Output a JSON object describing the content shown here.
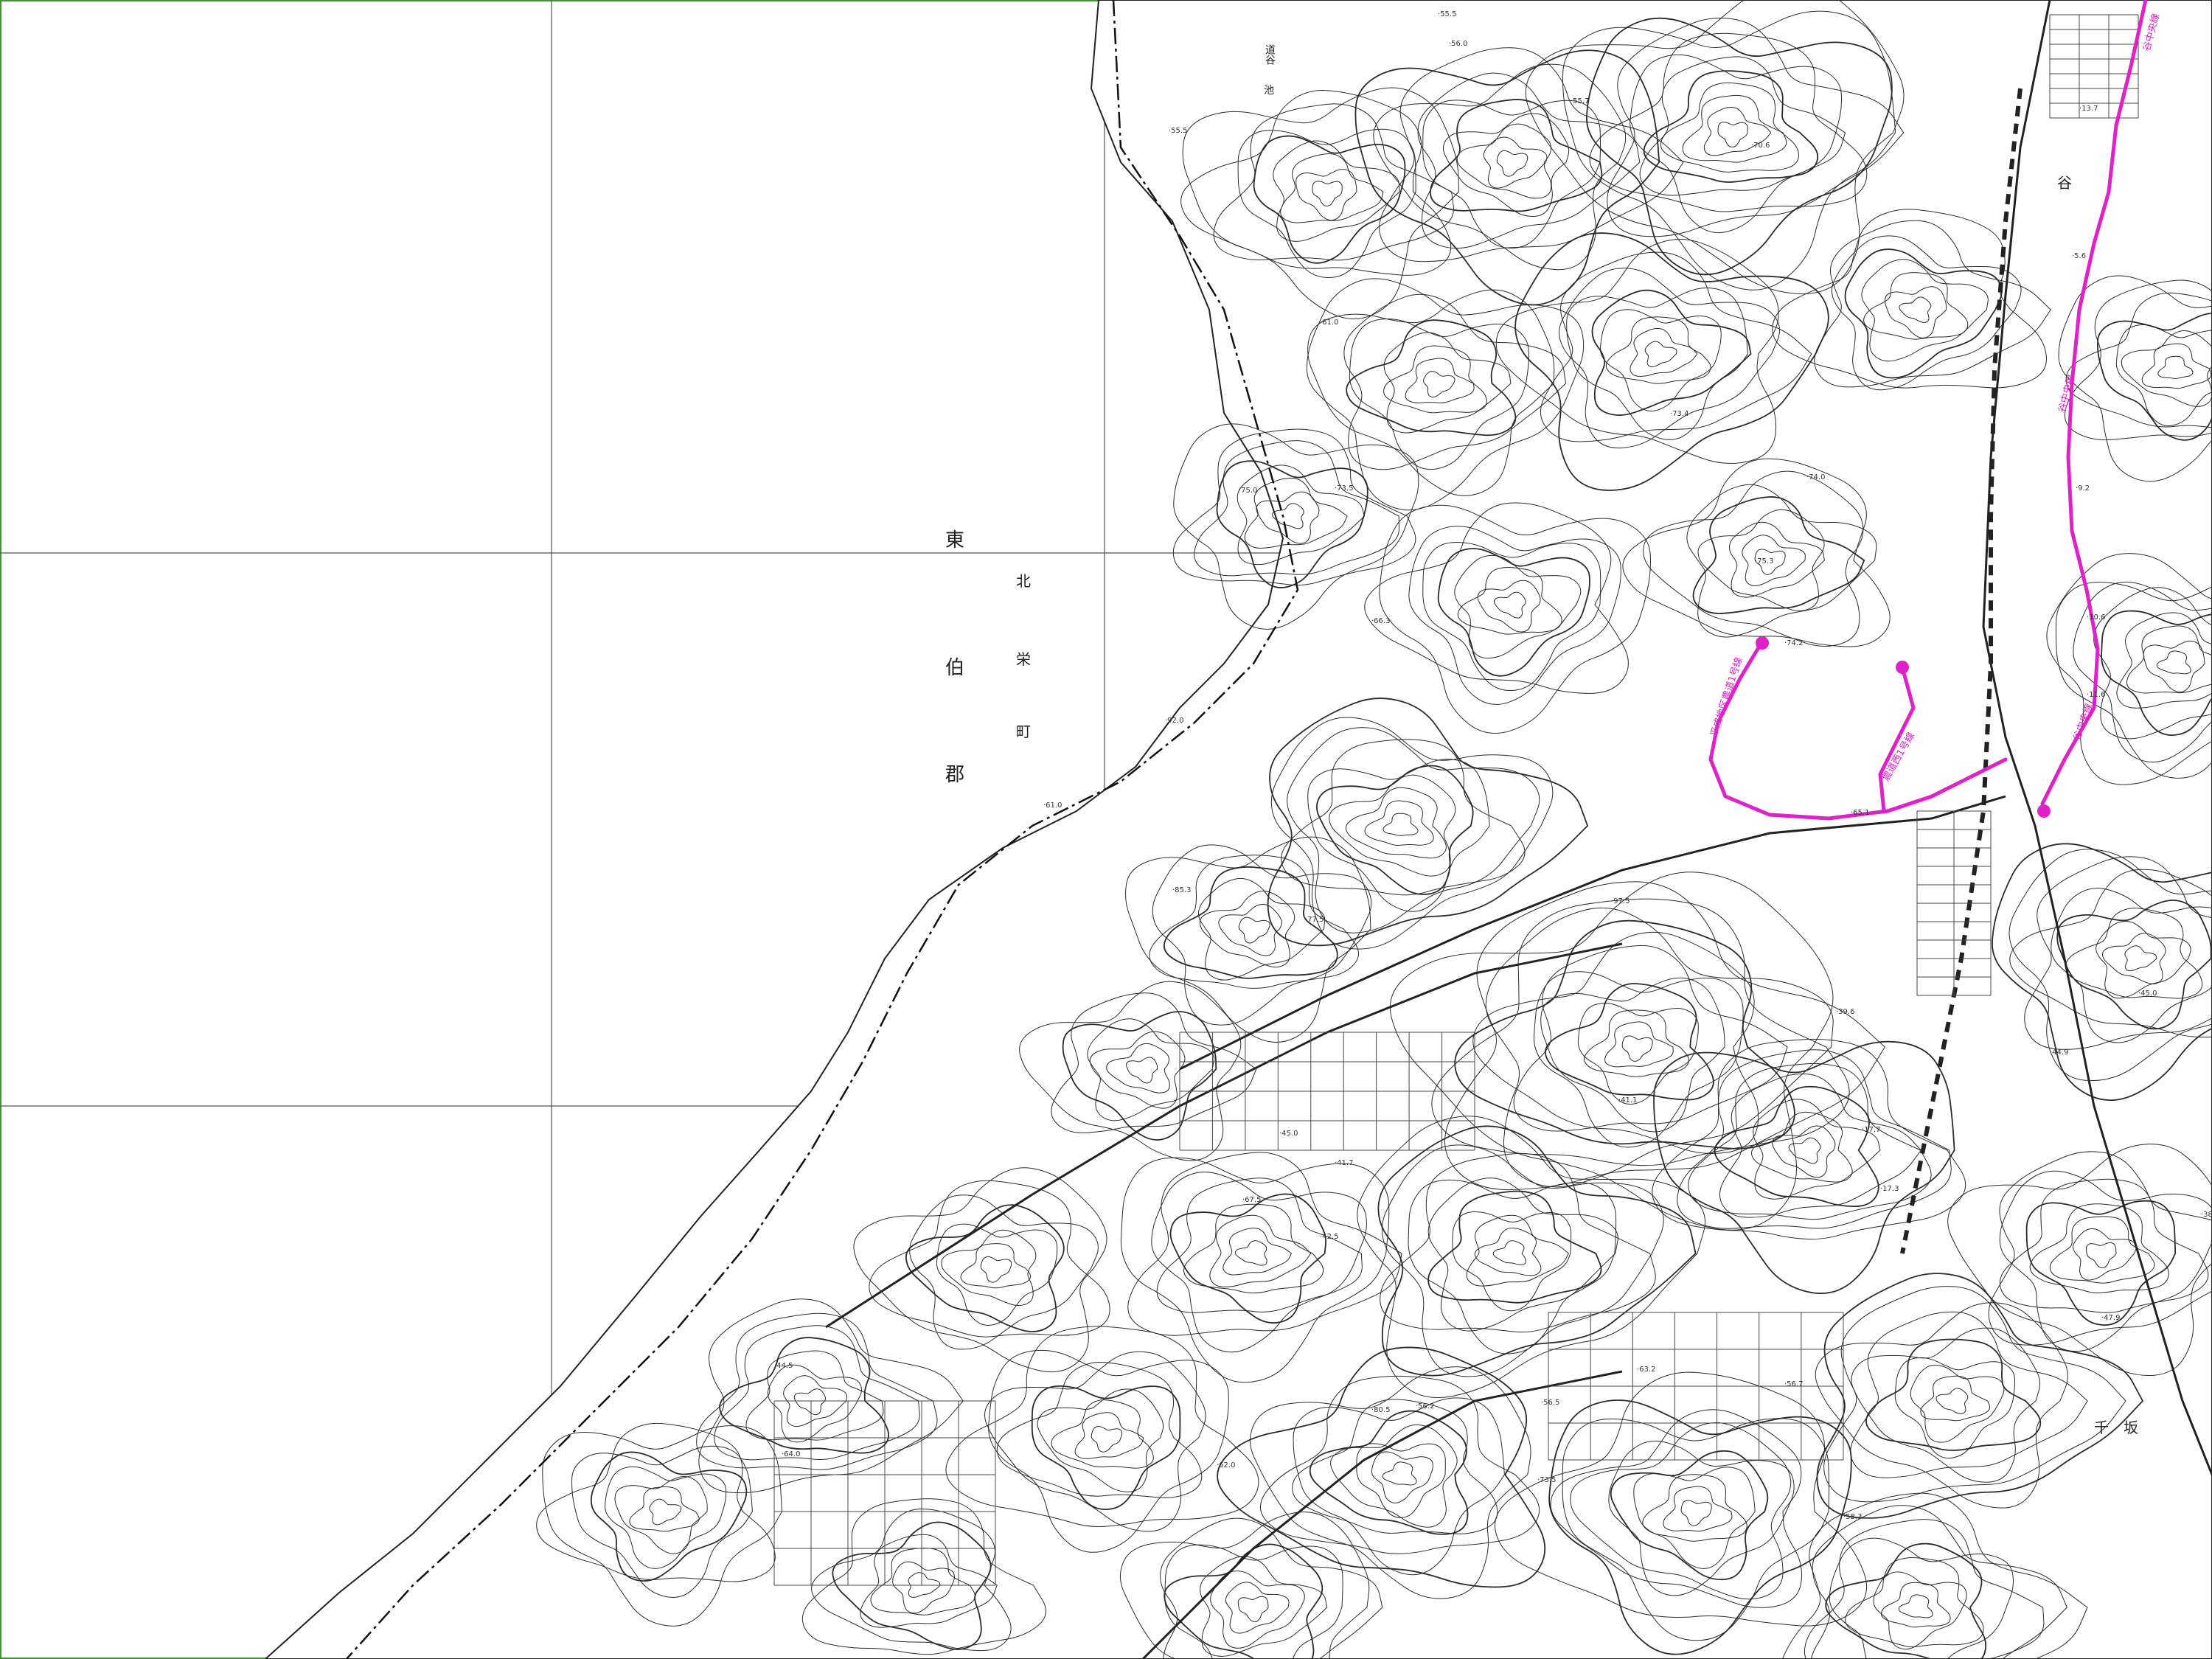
{
  "map": {
    "frame_color": "#3a9a2a",
    "grid_color": "#555555",
    "route_color": "#e020c8",
    "contour_color": "#2b2b2b"
  },
  "labels": {
    "east_label_higashi": "東",
    "east_label_haku": "伯",
    "east_label_gun": "郡",
    "north_label_kita": "北",
    "north_label_ei": "栄",
    "north_label_cho": "町",
    "pond": "池",
    "pond_prefix": "道谷",
    "tani": "谷",
    "senzaka_1": "千",
    "senzaka_2": "坂"
  },
  "routes": [
    {
      "name": "谷中央線"
    },
    {
      "name": "谷中央線"
    },
    {
      "name": "谷中央線"
    },
    {
      "name": "平成地区農道1号線"
    },
    {
      "name": "農道西1号線"
    }
  ],
  "elevations": [
    "55.5",
    "56.0",
    "55.7",
    "55.5",
    "70.6",
    "61.0",
    "75.0",
    "73.5",
    "74.0",
    "75.3",
    "73.4",
    "74.2",
    "66.3",
    "92.0",
    "61.0",
    "85.3",
    "77.5",
    "97.5",
    "65.1",
    "39.6",
    "41.1",
    "41.7",
    "45.0",
    "42.5",
    "67.5",
    "64.0",
    "44.5",
    "73.5",
    "62.0",
    "56.2",
    "80.5",
    "56.5",
    "63.2",
    "56.7",
    "58.3",
    "17.7",
    "17.3",
    "11.6",
    "10.6",
    "9.2",
    "5.6",
    "13.7",
    "45.0",
    "44.9",
    "38.5",
    "47.9"
  ]
}
